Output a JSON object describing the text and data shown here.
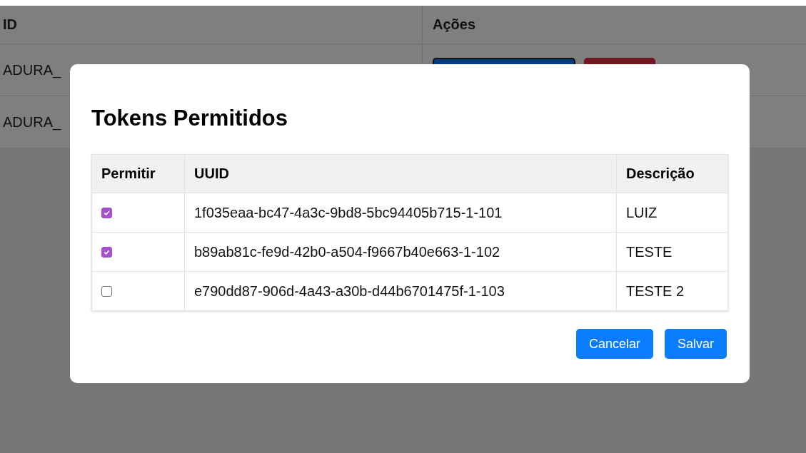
{
  "background_table": {
    "columns": [
      "ID",
      "Ações"
    ],
    "rows": [
      {
        "id": "ADURA_",
        "has_actions": true
      },
      {
        "id": "ADURA_"
      }
    ]
  },
  "modal": {
    "title": "Tokens Permitidos",
    "columns": [
      "Permitir",
      "UUID",
      "Descrição"
    ],
    "rows": [
      {
        "checked": true,
        "uuid": "1f035eaa-bc47-4a3c-9bd8-5bc94405b715-1-101",
        "description": "LUIZ"
      },
      {
        "checked": true,
        "uuid": "b89ab81c-fe9d-42b0-a504-f9667b40e663-1-102",
        "description": "TESTE"
      },
      {
        "checked": false,
        "uuid": "e790dd87-906d-4a43-a30b-d44b6701475f-1-103",
        "description": "TESTE 2"
      }
    ],
    "buttons": [
      "Cancelar",
      "Salvar"
    ]
  }
}
